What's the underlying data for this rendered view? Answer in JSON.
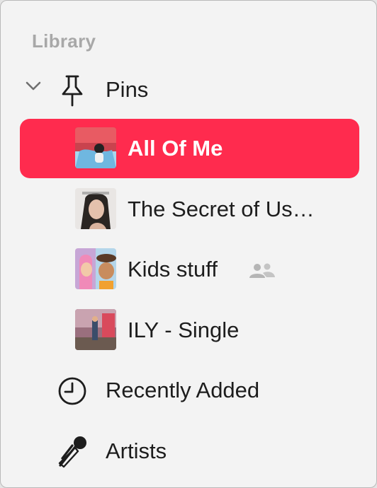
{
  "sidebar": {
    "section_title": "Library",
    "pins": {
      "label": "Pins",
      "chevron_icon": "chevron-down-icon",
      "pin_icon": "pushpin-icon",
      "items": [
        {
          "label": "All Of Me",
          "selected": true,
          "artwork": "album-artwork-all-of-me"
        },
        {
          "label": "The Secret of Us…",
          "selected": false,
          "artwork": "album-artwork-the-secret-of-us"
        },
        {
          "label": "Kids stuff",
          "selected": false,
          "artwork": "playlist-artwork-kids-stuff",
          "badge_icon": "shared-people-icon"
        },
        {
          "label": "ILY - Single",
          "selected": false,
          "artwork": "album-artwork-ily-single"
        }
      ]
    },
    "items": [
      {
        "label": "Recently Added",
        "icon": "clock-icon"
      },
      {
        "label": "Artists",
        "icon": "microphone-icon"
      }
    ]
  },
  "colors": {
    "selection": "#ff2b4e",
    "section_header": "#a8a8a8",
    "text": "#1d1d1d",
    "background": "#f3f3f3"
  }
}
